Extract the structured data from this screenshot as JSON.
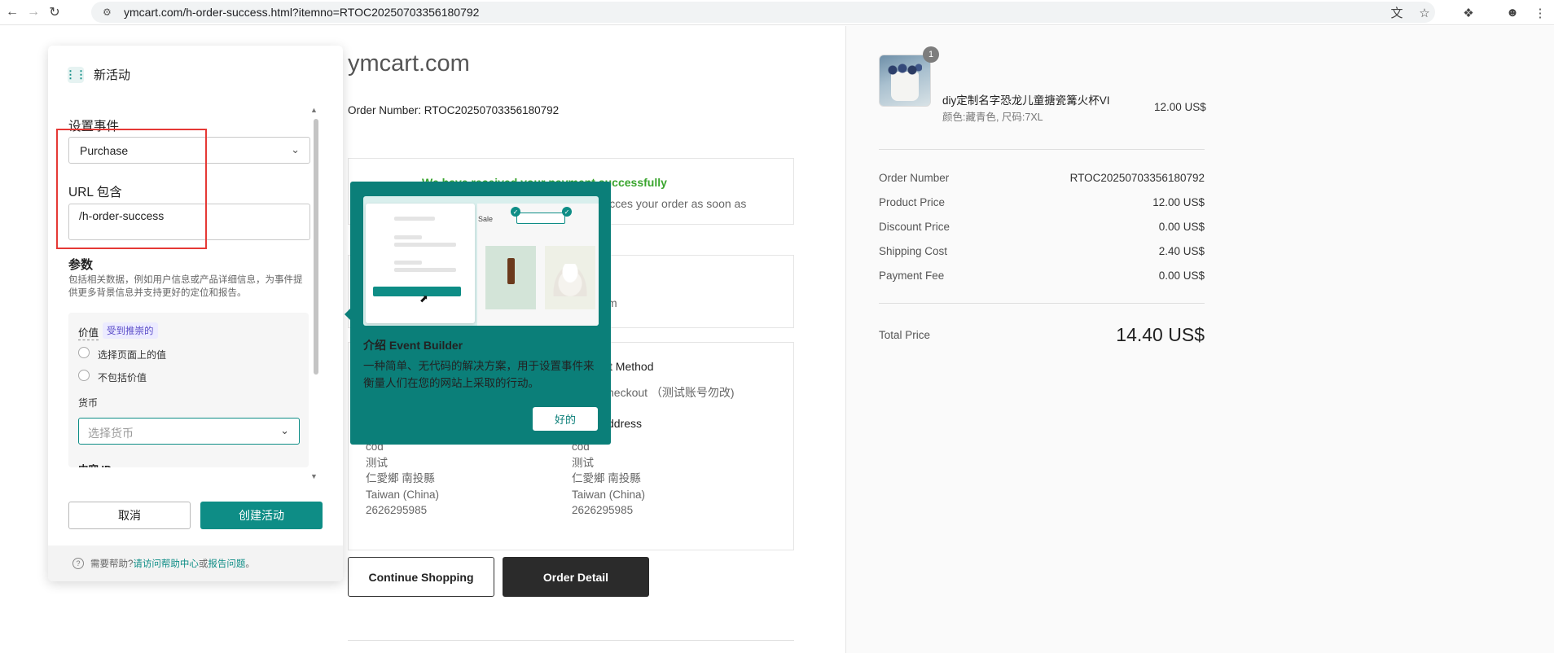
{
  "browser": {
    "url": "ymcart.com/h-order-success.html?itemno=RTOC20250703356180792"
  },
  "page": {
    "site_title": "ymcart.com",
    "order_number_line": "Order Number: RTOC20250703356180792",
    "payment_success": "We have received your payment successfully",
    "payment_process": "procces your order as soon as",
    "info_frag": "m",
    "payment_method_heading": "t Method",
    "payment_method_value": "heckout （测试账号勿改)",
    "address_heading": "ddress",
    "addr_left": [
      "cod",
      "测试",
      "仁愛鄉 南投縣",
      "Taiwan (China)",
      "2626295985"
    ],
    "addr_right": [
      "cod",
      "测试",
      "仁愛鄉 南投縣",
      "Taiwan (China)",
      "2626295985"
    ],
    "continue_shopping": "Continue Shopping",
    "order_detail": "Order Detail"
  },
  "summary": {
    "product_qty": "1",
    "product_name": "diy定制名字恐龙儿童搪瓷篝火杯VI",
    "product_variant": "颜色:藏青色, 尺码:7XL",
    "product_price": "12.00 US$",
    "rows": [
      {
        "label": "Order Number",
        "value": "RTOC20250703356180792"
      },
      {
        "label": "Product Price",
        "value": "12.00 US$"
      },
      {
        "label": "Discount Price",
        "value": "0.00 US$"
      },
      {
        "label": "Shipping Cost",
        "value": "2.40 US$"
      },
      {
        "label": "Payment Fee",
        "value": "0.00 US$"
      }
    ],
    "total_label": "Total Price",
    "total_value": "14.40 US$"
  },
  "panel": {
    "title": "新活动",
    "event_label": "设置事件",
    "event_value": "Purchase",
    "url_label": "URL 包含",
    "url_value": "/h-order-success",
    "params_label": "参数",
    "params_desc": "包括相关数据，例如用户信息或产品详细信息，为事件提供更多背景信息并支持更好的定位和报告。",
    "value_label": "价值",
    "recommended_badge": "受到推崇的",
    "radio_1": "选择页面上的值",
    "radio_2": "不包括价值",
    "currency_label": "货币",
    "currency_placeholder": "选择货币",
    "content_id_label": "内容 ID",
    "cancel": "取消",
    "create": "创建活动",
    "help_prefix": "需要帮助?",
    "help_link_1": "请访问帮助中心",
    "help_or": "或",
    "help_link_2": "报告问题",
    "help_suffix": "。"
  },
  "tooltip": {
    "sale_word": "Sale",
    "title": "介绍 Event Builder",
    "body": "一种简单、无代码的解决方案，用于设置事件来衡量人们在您的网站上采取的行动。",
    "ok": "好的"
  },
  "colors": {
    "accent": "#0e8d86",
    "tooltip_bg": "#0b7f79",
    "highlight": "#e53935",
    "success": "#3aa52e"
  }
}
